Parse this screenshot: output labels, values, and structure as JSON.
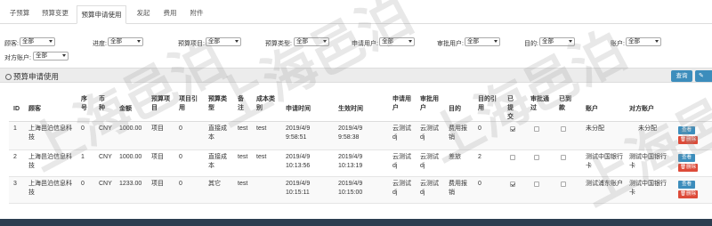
{
  "tabs": [
    {
      "label": "子预算"
    },
    {
      "label": "预算变更"
    },
    {
      "label": "预算申请使用"
    },
    {
      "label": "发起"
    },
    {
      "label": "费用"
    },
    {
      "label": "附件"
    }
  ],
  "filters": {
    "customer": {
      "label": "顾客:",
      "value": "全部"
    },
    "progress": {
      "label": "进度:",
      "value": "全部"
    },
    "budget_item": {
      "label": "预算项目:",
      "value": "全部"
    },
    "budget_type": {
      "label": "预算类型:",
      "value": "全部"
    },
    "applicant": {
      "label": "申请用户:",
      "value": "全部"
    },
    "approver": {
      "label": "审批用户:",
      "value": "全部"
    },
    "purpose": {
      "label": "目的:",
      "value": "全部"
    },
    "account": {
      "label": "账户:",
      "value": "全部"
    },
    "counter_account": {
      "label": "对方账户:",
      "value": "全部"
    }
  },
  "panel": {
    "title": "预算申请使用",
    "query_label": "查询",
    "edit_glyph": "✎"
  },
  "table": {
    "headers": {
      "id": "ID",
      "customer": "顾客",
      "seq": "序号",
      "currency": "币种",
      "amount": "金额",
      "budget_item": "预算项目",
      "ref_item": "项目引用",
      "budget_type": "预算类型",
      "note": "备注",
      "cost_type": "成本类别",
      "apply_time": "申请时间",
      "effective_time": "生效时间",
      "applicant": "申请用户",
      "approver": "审批用户",
      "purpose": "目的",
      "purpose_ref": "目的引用",
      "submitted": "已提交",
      "approved": "审批通过",
      "arrived": "已到款",
      "account": "账户",
      "counter_account": "对方账户"
    },
    "rows": [
      {
        "id": "1",
        "customer": "上海邑泊信息科技",
        "seq": "0",
        "currency": "CNY",
        "amount": "1000.00",
        "budget_item": "项目",
        "ref_item": "0",
        "budget_type": "直接成本",
        "note": "test",
        "cost_type": "test",
        "apply_time": "2019/4/9 9:58:51",
        "effective_time": "2019/4/9 9:58:38",
        "applicant": "云测试dj",
        "approver": "云测试dj",
        "purpose": "费用报销",
        "purpose_ref": "0",
        "submitted": true,
        "approved": false,
        "arrived": false,
        "account": "未分配",
        "counter_account": "未分配",
        "view_label": "查看",
        "delete_label": "删除"
      },
      {
        "id": "2",
        "customer": "上海邑泊信息科技",
        "seq": "1",
        "currency": "CNY",
        "amount": "1000.00",
        "budget_item": "项目",
        "ref_item": "0",
        "budget_type": "直接成本",
        "note": "test",
        "cost_type": "test",
        "apply_time": "2019/4/9 10:13:56",
        "effective_time": "2019/4/9 10:13:19",
        "applicant": "云测试dj",
        "approver": "云测试dj",
        "purpose": "差旅",
        "purpose_ref": "2",
        "submitted": false,
        "approved": false,
        "arrived": false,
        "account": "测试中国银行卡",
        "counter_account": "测试中国银行卡",
        "view_label": "查看",
        "delete_label": "删除"
      },
      {
        "id": "3",
        "customer": "上海邑泊信息科技",
        "seq": "0",
        "currency": "CNY",
        "amount": "1233.00",
        "budget_item": "项目",
        "ref_item": "0",
        "budget_type": "其它",
        "note": "test",
        "cost_type": "",
        "apply_time": "2019/4/9 10:15:11",
        "effective_time": "2019/4/9 10:15:00",
        "applicant": "云测试dj",
        "approver": "云测试dj",
        "purpose": "费用报销",
        "purpose_ref": "0",
        "submitted": true,
        "approved": false,
        "arrived": false,
        "account": "测试浦东账户",
        "counter_account": "测试中国银行卡",
        "view_label": "查看",
        "delete_label": "删除"
      }
    ]
  },
  "watermark": "上海邑泊"
}
